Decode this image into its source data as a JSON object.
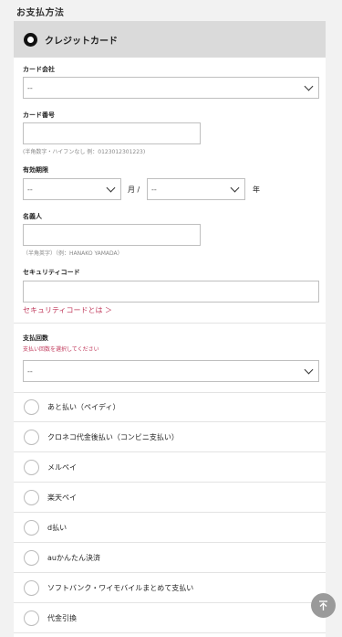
{
  "section_title": "お支払方法",
  "credit_card": {
    "label": "クレジットカード",
    "card_company": {
      "label": "カード会社",
      "value": "--"
    },
    "card_number": {
      "label": "カード番号",
      "hint": "(半角数字・ハイフンなし 例：0123012301223)"
    },
    "expiry": {
      "label": "有効期限",
      "month_value": "--",
      "month_unit": "月 /",
      "year_value": "--",
      "year_unit": "年"
    },
    "holder": {
      "label": "名義人",
      "hint": "（半角英字）（例：HANAKO YAMADA）"
    },
    "security": {
      "label": "セキュリティコード",
      "link": "セキュリティコードとは ＞"
    }
  },
  "installments": {
    "label": "支払回数",
    "warning": "支払い回数を選択してください",
    "value": "--"
  },
  "payment_options": [
    "あと払い（ペイディ）",
    "クロネコ代金後払い（コンビニ支払い）",
    "メルペイ",
    "楽天ペイ",
    "d払い",
    "auかんたん決済",
    "ソフトバンク・ワイモバイルまとめて支払い",
    "代金引換"
  ]
}
